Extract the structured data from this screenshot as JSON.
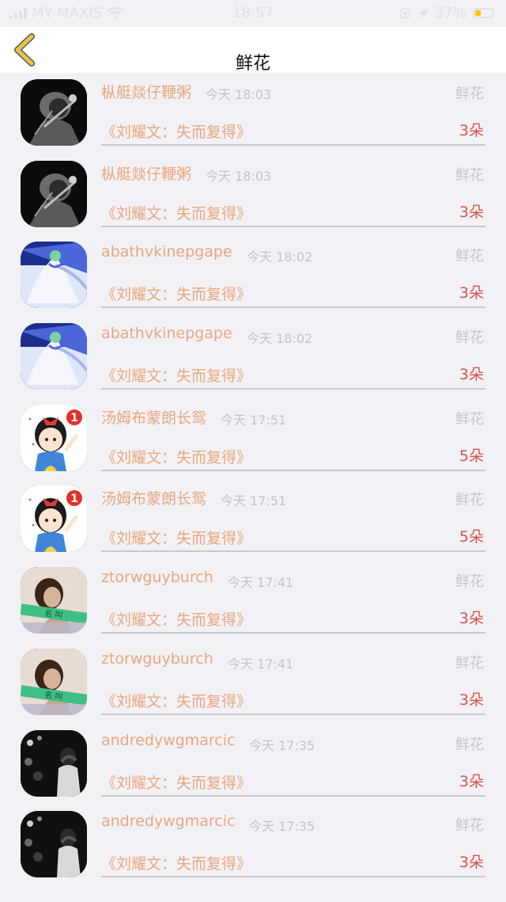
{
  "status_bar": {
    "carrier": "MY MAXIS",
    "time": "18:57",
    "battery": "37%",
    "battery_level": 0.37,
    "battery_color": "#f5c800"
  },
  "nav": {
    "title": "鲜花",
    "back_icon": "chevron-left-icon",
    "back_color": "#e8c34a"
  },
  "colors": {
    "accent_text": "#e8a77e",
    "count_text": "#d9544b"
  },
  "items": [
    {
      "name": "枞艇燚仔鞭粥",
      "time": "今天 18:03",
      "tag": "鲜花",
      "title": "《刘耀文：失而复得》",
      "count": "3朵",
      "avatar": "avatar-dark-guitarist"
    },
    {
      "name": "枞艇燚仔鞭粥",
      "time": "今天 18:03",
      "tag": "鲜花",
      "title": "《刘耀文：失而复得》",
      "count": "3朵",
      "avatar": "avatar-dark-guitarist"
    },
    {
      "name": "abathvkinepgape",
      "time": "今天 18:02",
      "tag": "鲜花",
      "title": "《刘耀文：失而复得》",
      "count": "3朵",
      "avatar": "avatar-anime-dancer"
    },
    {
      "name": "abathvkinepgape",
      "time": "今天 18:02",
      "tag": "鲜花",
      "title": "《刘耀文：失而复得》",
      "count": "3朵",
      "avatar": "avatar-anime-dancer"
    },
    {
      "name": "汤姆布蒙朗长鸳",
      "time": "今天 17:51",
      "tag": "鲜花",
      "title": "《刘耀文：失而复得》",
      "count": "5朵",
      "avatar": "avatar-cartoon-girl",
      "badge": "1"
    },
    {
      "name": "汤姆布蒙朗长鸳",
      "time": "今天 17:51",
      "tag": "鲜花",
      "title": "《刘耀文：失而复得》",
      "count": "5朵",
      "avatar": "avatar-cartoon-girl",
      "badge": "1"
    },
    {
      "name": "ztorwguyburch",
      "time": "今天 17:41",
      "tag": "鲜花",
      "title": "《刘耀文：失而复得》",
      "count": "3朵",
      "avatar": "avatar-woman-portrait"
    },
    {
      "name": "ztorwguyburch",
      "time": "今天 17:41",
      "tag": "鲜花",
      "title": "《刘耀文：失而复得》",
      "count": "3朵",
      "avatar": "avatar-woman-portrait"
    },
    {
      "name": "andredywgmarcic",
      "time": "今天 17:35",
      "tag": "鲜花",
      "title": "《刘耀文：失而复得》",
      "count": "3朵",
      "avatar": "avatar-night-photo"
    },
    {
      "name": "andredywgmarcic",
      "time": "今天 17:35",
      "tag": "鲜花",
      "title": "《刘耀文：失而复得》",
      "count": "3朵",
      "avatar": "avatar-night-photo"
    }
  ]
}
